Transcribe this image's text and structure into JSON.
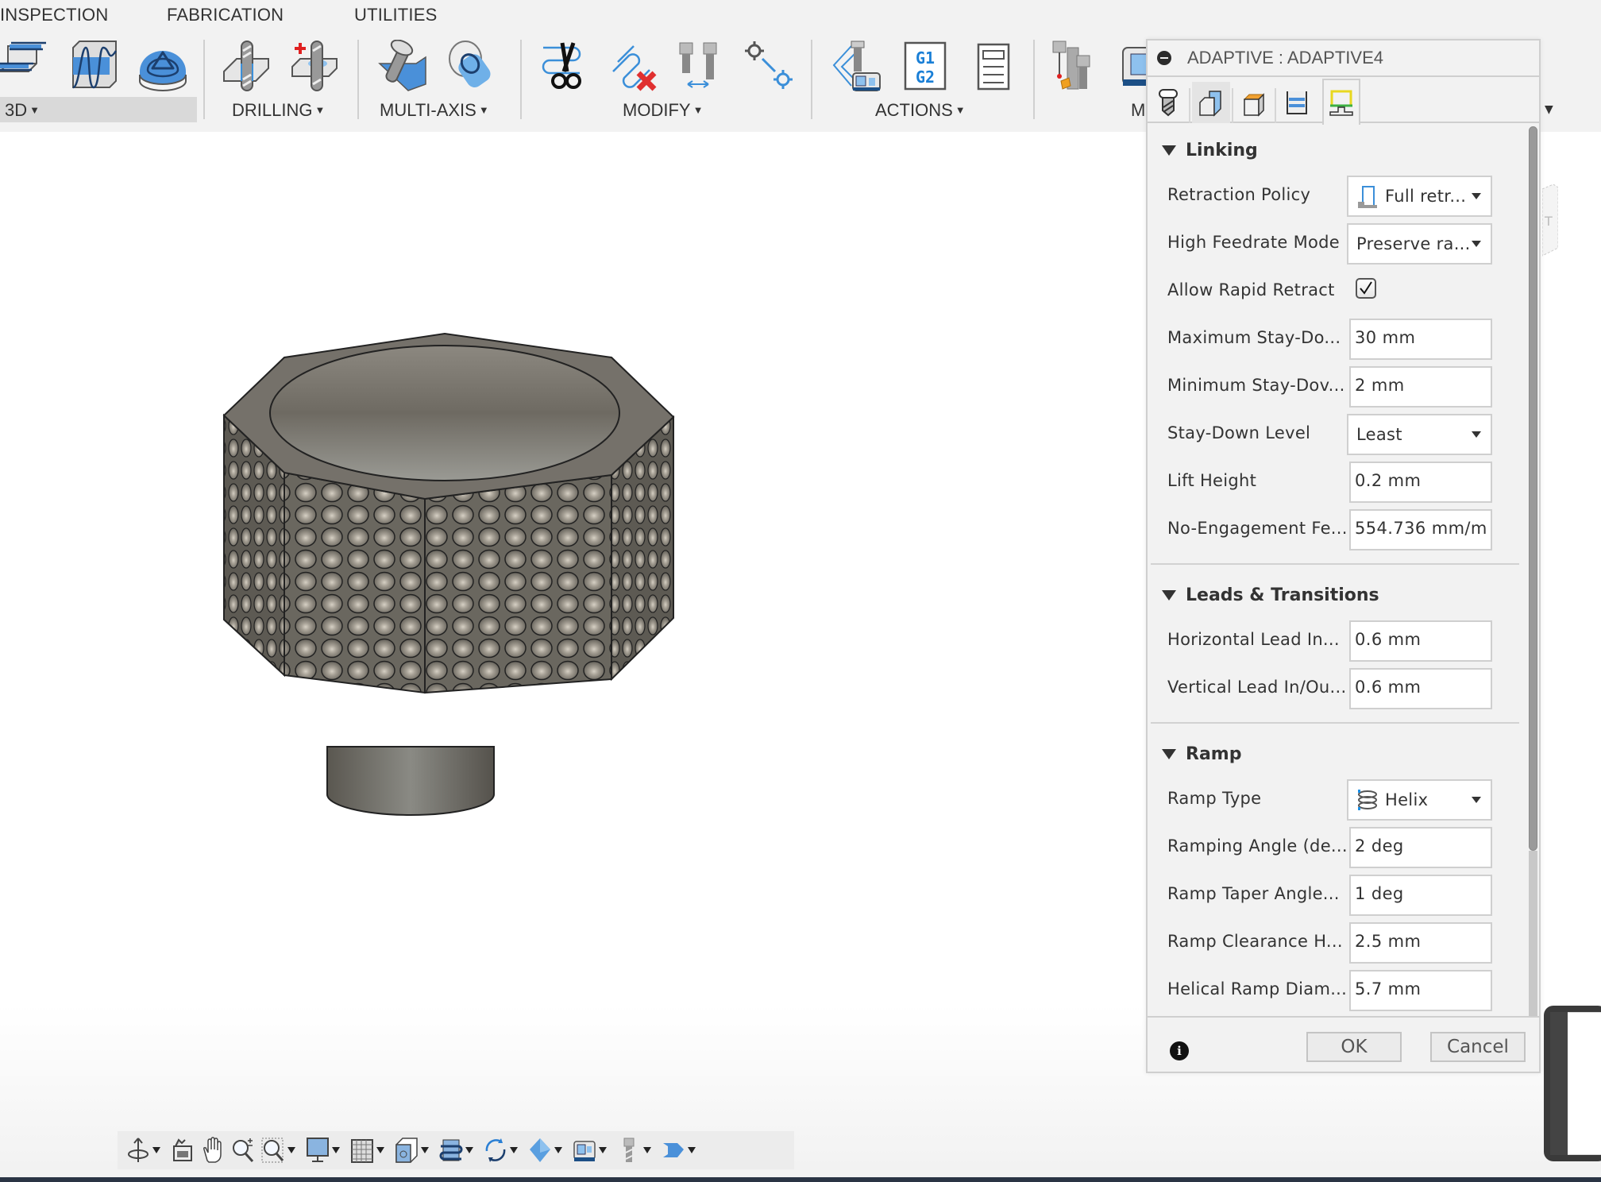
{
  "top_tabs": [
    "INSPECTION",
    "FABRICATION",
    "UTILITIES"
  ],
  "toolbar_groups": [
    {
      "label": "3D",
      "has_dropdown": true,
      "selected": true,
      "icons": [
        "adaptive-clearing-icon",
        "pocket-clearing-icon",
        "steep-shallow-icon"
      ]
    },
    {
      "label": "DRILLING",
      "has_dropdown": true,
      "icons": [
        "drill-icon",
        "hole-recognition-icon"
      ]
    },
    {
      "label": "MULTI-AXIS",
      "has_dropdown": true,
      "icons": [
        "swarf-icon",
        "multi-axis-contour-icon"
      ]
    },
    {
      "label": "MODIFY",
      "has_dropdown": true,
      "icons": [
        "trim-toolpath-icon",
        "delete-toolpath-icon",
        "tool-move-icon",
        "point-transform-icon"
      ]
    },
    {
      "label": "ACTIONS",
      "has_dropdown": true,
      "icons": [
        "simulate-icon",
        "post-process-icon",
        "setup-sheet-icon"
      ]
    },
    {
      "label": "M",
      "has_dropdown": true,
      "icons": [
        "tool-library-icon",
        "machine-library-icon"
      ]
    }
  ],
  "dialog": {
    "title": "ADAPTIVE : ADAPTIVE4",
    "tabs": [
      {
        "name": "tool",
        "icon": "tool-icon"
      },
      {
        "name": "geometry",
        "icon": "geometry-icon"
      },
      {
        "name": "heights",
        "icon": "heights-icon"
      },
      {
        "name": "passes",
        "icon": "passes-icon"
      },
      {
        "name": "linking",
        "icon": "linking-icon",
        "active": true
      }
    ],
    "sections": {
      "linking": {
        "title": "Linking",
        "fields": {
          "retraction_policy": {
            "label": "Retraction Policy",
            "value": "Full retr..."
          },
          "high_feedrate_mode": {
            "label": "High Feedrate Mode",
            "value": "Preserve ra..."
          },
          "allow_rapid_retract": {
            "label": "Allow Rapid Retract",
            "checked": true
          },
          "max_stay_down": {
            "label": "Maximum Stay-Do...",
            "value": "30 mm"
          },
          "min_stay_down": {
            "label": "Minimum Stay-Dov...",
            "value": "2 mm"
          },
          "stay_down_level": {
            "label": "Stay-Down Level",
            "value": "Least"
          },
          "lift_height": {
            "label": "Lift Height",
            "value": "0.2 mm"
          },
          "no_engagement_feed": {
            "label": "No-Engagement Fe...",
            "value": "554.736 mm/m"
          }
        }
      },
      "leads": {
        "title": "Leads & Transitions",
        "fields": {
          "horizontal_lead": {
            "label": "Horizontal Lead In...",
            "value": "0.6 mm"
          },
          "vertical_lead": {
            "label": "Vertical Lead In/Ou...",
            "value": "0.6 mm"
          }
        }
      },
      "ramp": {
        "title": "Ramp",
        "fields": {
          "ramp_type": {
            "label": "Ramp Type",
            "value": "Helix"
          },
          "ramping_angle": {
            "label": "Ramping Angle (de...",
            "value": "2 deg"
          },
          "ramp_taper_angle": {
            "label": "Ramp Taper Angle...",
            "value": "1 deg"
          },
          "ramp_clearance": {
            "label": "Ramp Clearance H...",
            "value": "2.5 mm"
          },
          "helical_ramp_diameter": {
            "label": "Helical Ramp Diam...",
            "value": "5.7 mm"
          }
        }
      }
    },
    "ok_label": "OK",
    "cancel_label": "Cancel"
  },
  "nav_bar": [
    {
      "icon": "orbit-icon",
      "dropdown": true
    },
    {
      "icon": "look-at-icon",
      "dropdown": false
    },
    {
      "icon": "pan-hand-icon",
      "dropdown": false
    },
    {
      "icon": "zoom-icon",
      "dropdown": false
    },
    {
      "icon": "zoom-window-icon",
      "dropdown": true
    },
    {
      "icon": "display-settings-icon",
      "dropdown": true
    },
    {
      "icon": "grid-icon",
      "dropdown": true
    },
    {
      "icon": "view-cube-icon",
      "dropdown": true
    },
    {
      "icon": "toolpath-display-icon",
      "dropdown": true
    },
    {
      "icon": "rotate-icon",
      "dropdown": true
    },
    {
      "icon": "stock-icon",
      "dropdown": true
    },
    {
      "icon": "machine-icon",
      "dropdown": true
    },
    {
      "icon": "tool-display-icon",
      "dropdown": true
    },
    {
      "icon": "fixture-icon",
      "dropdown": true
    }
  ],
  "colors": {
    "accent_blue": "#3b8fd9",
    "light_blue": "#6fb0e8",
    "toolbar_bg": "#f2f2f2",
    "dialog_bg": "#f2f2f2",
    "model_gray": "#5e5b55"
  }
}
